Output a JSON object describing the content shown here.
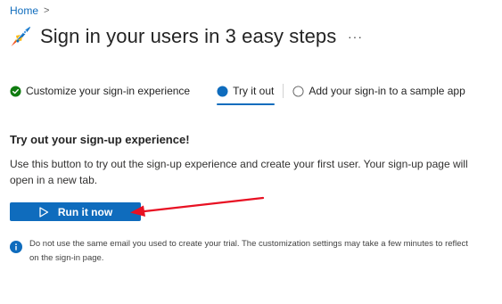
{
  "breadcrumb": {
    "home": "Home",
    "separator": ">"
  },
  "header": {
    "title": "Sign in your users in 3 easy steps",
    "more": "···",
    "icon": "rocket-icon"
  },
  "steps": [
    {
      "label": "Customize your sign-in experience",
      "state": "completed",
      "icon": "check-circle-icon"
    },
    {
      "label": "Try it out",
      "state": "active",
      "icon": "radio-filled-icon"
    },
    {
      "label": "Add your sign-in to a sample app",
      "state": "pending",
      "icon": "radio-empty-icon"
    }
  ],
  "content": {
    "heading": "Try out your sign-up experience!",
    "description": "Use this button to try out the sign-up experience and create your first user. Your sign-up page will open in a new tab.",
    "run_button": "Run it now",
    "info": "Do not use the same email you used to create your trial. The customization settings may take a few minutes to reflect on the sign-in page."
  },
  "colors": {
    "accent": "#0f6cbd",
    "success": "#107c10",
    "annotation_arrow": "#e81123"
  }
}
